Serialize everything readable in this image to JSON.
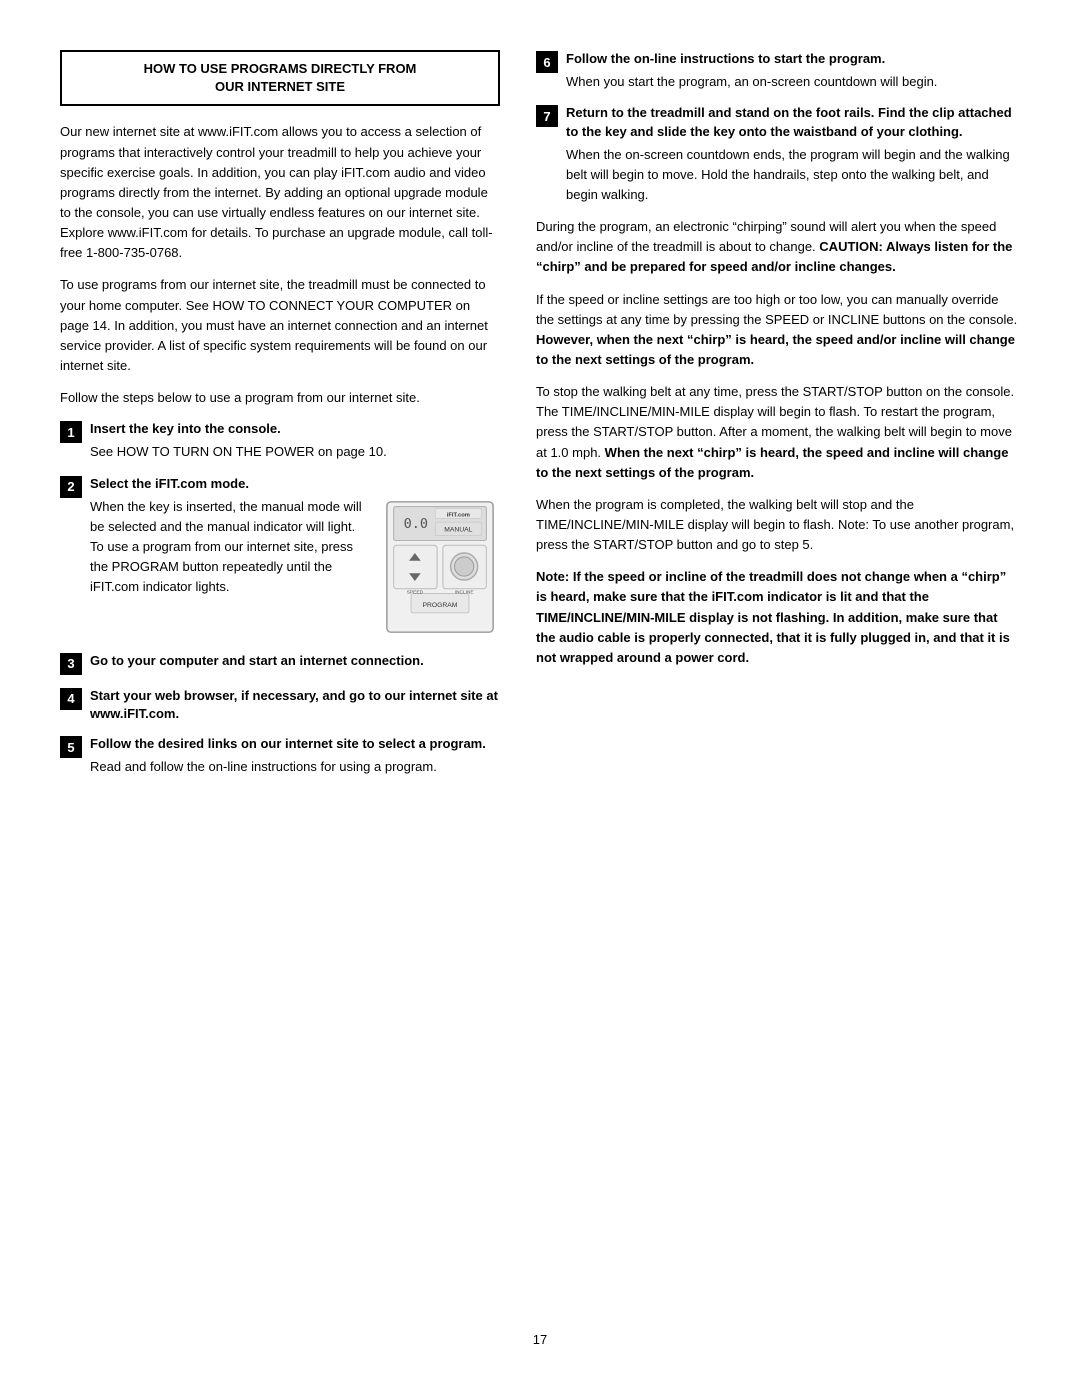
{
  "page": {
    "number": "17"
  },
  "header": {
    "title_line1": "HOW TO USE PROGRAMS DIRECTLY FROM",
    "title_line2": "OUR INTERNET SITE"
  },
  "left": {
    "intro1": "Our new internet site at www.iFIT.com allows you to access a selection of programs that interactively control your treadmill to help you achieve your specific exercise goals. In addition, you can play iFIT.com audio and video programs directly from the internet. By adding an optional upgrade module to the console, you can use virtually endless features on our internet site. Explore www.iFIT.com for details. To purchase an upgrade module, call toll-free 1-800-735-0768.",
    "intro2": "To use programs from our internet site, the treadmill must be connected to your home computer. See HOW TO CONNECT YOUR COMPUTER on page 14. In addition, you must have an internet connection and an internet service provider. A list of specific system requirements will be found on our internet site.",
    "intro3": "Follow the steps below to use a program from our internet site.",
    "step1_title": "Insert the key into the console.",
    "step1_body": "See HOW TO TURN ON THE POWER on page 10.",
    "step2_title": "Select the iFIT.com mode.",
    "step2_body": "When the key is inserted, the manual mode will be selected and the manual indicator will light. To use a program from our internet site, press the PROGRAM button repeatedly until the iFIT.com indicator lights.",
    "step3_title": "Go to your computer and start an internet connection.",
    "step4_title": "Start your web browser, if necessary, and go to our internet site at www.iFIT.com.",
    "step5_title": "Follow the desired links on our internet site to select a program.",
    "step5_body": "Read and follow the on-line instructions for using a program."
  },
  "right": {
    "step6_title": "Follow the on-line instructions to start the program.",
    "step6_body": "When you start the program, an on-screen countdown will begin.",
    "step7_title": "Return to the treadmill and stand on the foot rails. Find the clip attached to the key and slide the key onto the waistband of your clothing.",
    "step7_body": "When the on-screen countdown ends, the program will begin and the walking belt will begin to move. Hold the handrails, step onto the walking belt, and begin walking.",
    "para1": "During the program, an electronic “chirping” sound will alert you when the speed and/or incline of the treadmill is about to change.",
    "para1_bold": "CAUTION: Always listen for the “chirp” and be prepared for speed and/or incline changes.",
    "para2": "If the speed or incline settings are too high or too low, you can manually override the settings at any time by pressing the SPEED or INCLINE buttons on the console.",
    "para2_bold": "However, when the next “chirp” is heard, the speed and/or incline will change to the next settings of the program.",
    "para3": "To stop the walking belt at any time, press the START/STOP button on the console. The TIME/INCLINE/MIN-MILE display will begin to flash. To restart the program, press the START/STOP button. After a moment, the walking belt will begin to move at 1.0 mph.",
    "para3_bold": "When the next “chirp” is heard, the speed and incline will change to the next settings of the program.",
    "para4": "When the program is completed, the walking belt will stop and the TIME/INCLINE/MIN-MILE display will begin to flash. Note: To use another program, press the START/STOP button and go to step 5.",
    "para5_bold": "Note: If the speed or incline of the treadmill does not change when a “chirp” is heard, make sure that the iFIT.com indicator is lit and that the TIME/INCLINE/MIN-MILE display is not flashing. In addition, make sure that the audio cable is properly connected, that it is fully plugged in, and that it is not wrapped around a power cord."
  }
}
